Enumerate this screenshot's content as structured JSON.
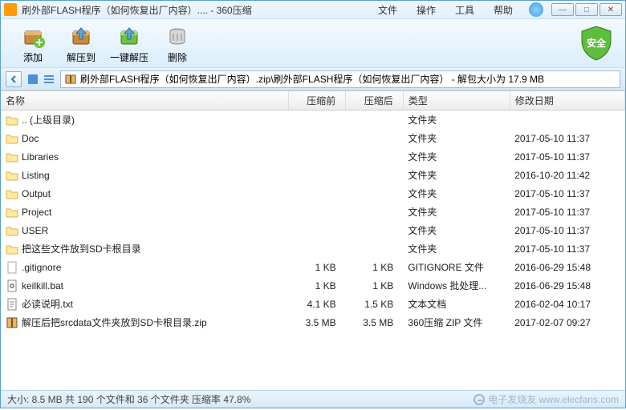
{
  "window": {
    "title": "刷外部FLASH程序（如何恢复出厂内容）.... - 360压缩"
  },
  "menu": {
    "file": "文件",
    "operation": "操作",
    "tools": "工具",
    "help": "帮助"
  },
  "toolbar": {
    "add": "添加",
    "extract_to": "解压到",
    "one_click": "一键解压",
    "delete": "删除"
  },
  "safety_badge": "安全",
  "path": {
    "text": "刷外部FLASH程序（如何恢复出厂内容）.zip\\刷外部FLASH程序（如何恢复出厂内容） - 解包大小为 17.9 MB"
  },
  "columns": {
    "name": "名称",
    "size_before": "压缩前",
    "size_after": "压缩后",
    "type": "类型",
    "modified": "修改日期"
  },
  "rows": [
    {
      "icon": "folder",
      "name": ".. (上级目录)",
      "before": "",
      "after": "",
      "type": "文件夹",
      "date": ""
    },
    {
      "icon": "folder",
      "name": "Doc",
      "before": "",
      "after": "",
      "type": "文件夹",
      "date": "2017-05-10 11:37"
    },
    {
      "icon": "folder",
      "name": "Libraries",
      "before": "",
      "after": "",
      "type": "文件夹",
      "date": "2017-05-10 11:37"
    },
    {
      "icon": "folder",
      "name": "Listing",
      "before": "",
      "after": "",
      "type": "文件夹",
      "date": "2016-10-20 11:42"
    },
    {
      "icon": "folder",
      "name": "Output",
      "before": "",
      "after": "",
      "type": "文件夹",
      "date": "2017-05-10 11:37"
    },
    {
      "icon": "folder",
      "name": "Project",
      "before": "",
      "after": "",
      "type": "文件夹",
      "date": "2017-05-10 11:37"
    },
    {
      "icon": "folder",
      "name": "USER",
      "before": "",
      "after": "",
      "type": "文件夹",
      "date": "2017-05-10 11:37"
    },
    {
      "icon": "folder",
      "name": "把这些文件放到SD卡根目录",
      "before": "",
      "after": "",
      "type": "文件夹",
      "date": "2017-05-10 11:37"
    },
    {
      "icon": "file",
      "name": ".gitignore",
      "before": "1 KB",
      "after": "1 KB",
      "type": "GITIGNORE 文件",
      "date": "2016-06-29 15:48"
    },
    {
      "icon": "bat",
      "name": "keilkill.bat",
      "before": "1 KB",
      "after": "1 KB",
      "type": "Windows 批处理...",
      "date": "2016-06-29 15:48"
    },
    {
      "icon": "txt",
      "name": "必读说明.txt",
      "before": "4.1 KB",
      "after": "1.5 KB",
      "type": "文本文档",
      "date": "2016-02-04 10:17"
    },
    {
      "icon": "zip",
      "name": "解压后把srcdata文件夹放到SD卡根目录.zip",
      "before": "3.5 MB",
      "after": "3.5 MB",
      "type": "360压缩 ZIP 文件",
      "date": "2017-02-07 09:27"
    }
  ],
  "statusbar": {
    "text": "大小: 8.5 MB 共 190 个文件和 36 个文件夹 压缩率 47.8%"
  },
  "watermark": "电子发烧友 www.elecfans.com"
}
